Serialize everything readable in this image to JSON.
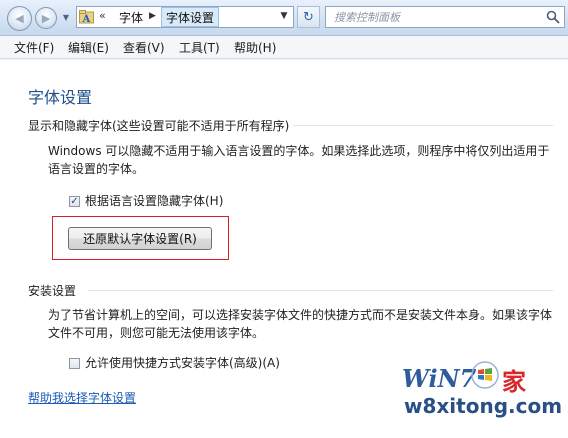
{
  "address_bar": {
    "chevrons": "«",
    "crumbs": [
      "字体",
      "字体设置"
    ],
    "search_placeholder": "搜索控制面板"
  },
  "menu": [
    "文件(F)",
    "编辑(E)",
    "查看(V)",
    "工具(T)",
    "帮助(H)"
  ],
  "page": {
    "title": "字体设置",
    "section1_title": "显示和隐藏字体(这些设置可能不适用于所有程序)",
    "section1_desc_line1": "Windows 可以隐藏不适用于输入语言设置的字体。如果选择此选项，则程序中将仅列出适用于",
    "section1_desc_line2": "语言设置的字体。",
    "hide_fonts_checkbox": {
      "label": "根据语言设置隐藏字体(H)",
      "checked": true
    },
    "restore_button": "还原默认字体设置(R)",
    "section2_title": "安装设置",
    "section2_desc_line1": "为了节省计算机上的空间，可以选择安装字体文件的快捷方式而不是安装文件本身。如果该字体",
    "section2_desc_line2": "文件不可用，则您可能无法使用该字体。",
    "shortcut_checkbox": {
      "label": "允许使用快捷方式安装字体(高级)(A)",
      "checked": false
    },
    "help_link": "帮助我选择字体设置"
  },
  "watermark": {
    "brand": "WiN7",
    "jia": "家",
    "site": "w8xitong.com"
  },
  "colors": {
    "title_blue": "#1e4e8c",
    "link_blue": "#1a5bb5",
    "highlight_red": "#d62024"
  }
}
